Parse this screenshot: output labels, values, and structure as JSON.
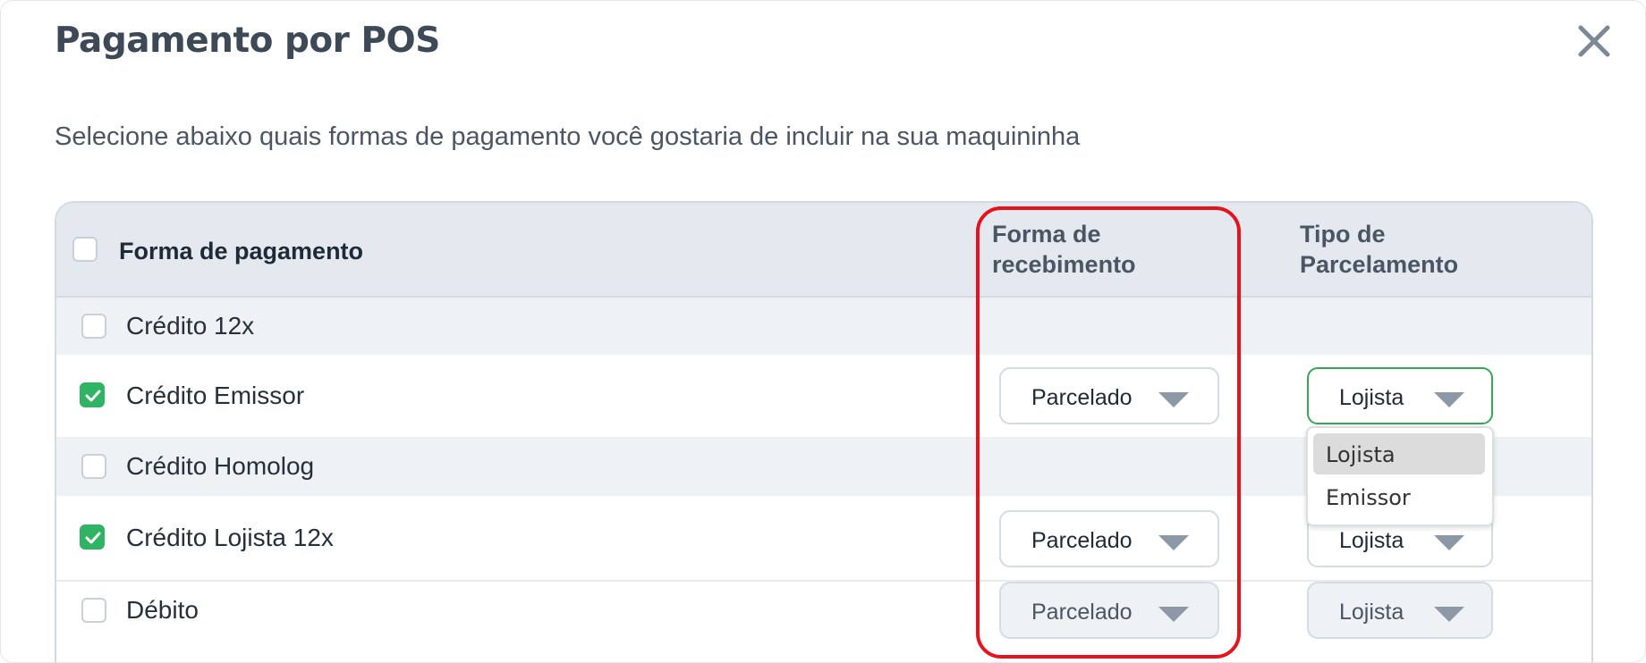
{
  "modal": {
    "title": "Pagamento por POS",
    "subtitle": "Selecione abaixo quais formas de pagamento você gostaria de incluir na sua maquininha",
    "close_icon": "close-icon"
  },
  "table": {
    "headers": {
      "payment_method": "Forma de pagamento",
      "receipt_line1": "Forma de",
      "receipt_line2": "recebimento",
      "installment_line1": "Tipo de",
      "installment_line2": "Parcelamento"
    },
    "rows": [
      {
        "label": "Crédito 12x",
        "checked": false
      },
      {
        "label": "Crédito Emissor",
        "checked": true,
        "receipt": "Parcelado",
        "installment": "Lojista"
      },
      {
        "label": "Crédito Homolog",
        "checked": false
      },
      {
        "label": "Crédito Lojista 12x",
        "checked": true,
        "receipt": "Parcelado",
        "installment": "Lojista"
      },
      {
        "label": "Débito",
        "checked": false,
        "receipt": "Parcelado",
        "installment": "Lojista"
      }
    ]
  },
  "dropdown": {
    "options": [
      "Lojista",
      "Emissor"
    ],
    "selected": "Lojista"
  },
  "colors": {
    "checkbox_checked": "#2fb463",
    "highlight_border": "#e6131d",
    "active_select_border": "#34a853"
  }
}
